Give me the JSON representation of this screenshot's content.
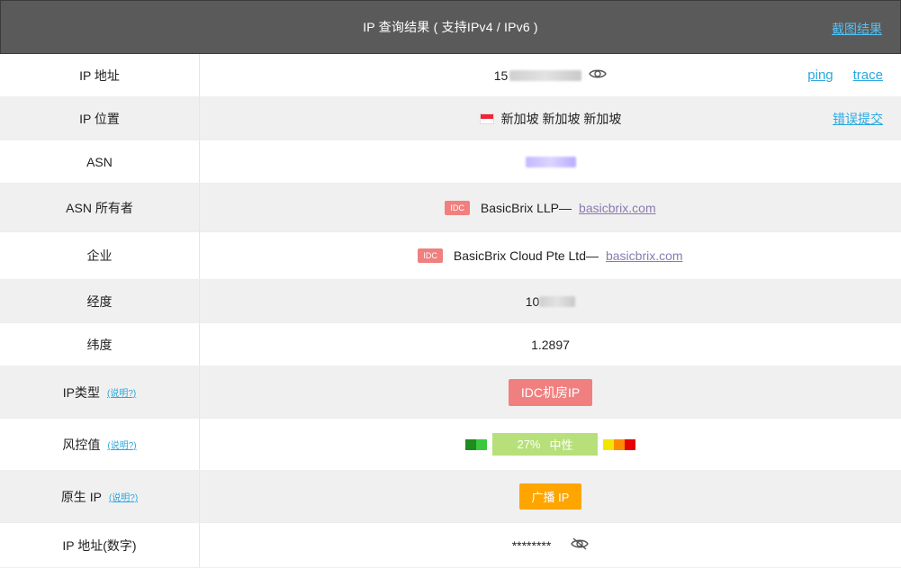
{
  "header": {
    "title": "IP 查询结果 ( 支持IPv4 / IPv6 )",
    "screenshot_link": "截图结果"
  },
  "rows": {
    "ip_address": {
      "label": "IP 地址",
      "value_prefix": "15",
      "links": [
        "ping",
        "trace"
      ]
    },
    "ip_location": {
      "label": "IP 位置",
      "value": "新加坡 新加坡 新加坡",
      "report_link": "错误提交"
    },
    "asn": {
      "label": "ASN"
    },
    "asn_owner": {
      "label": "ASN 所有者",
      "tag": "IDC",
      "name": "BasicBrix LLP—",
      "domain": "basicbrix.com"
    },
    "enterprise": {
      "label": "企业",
      "tag": "IDC",
      "name": "BasicBrix Cloud Pte Ltd—",
      "domain": "basicbrix.com"
    },
    "longitude": {
      "label": "经度",
      "value_prefix": "10"
    },
    "latitude": {
      "label": "纬度",
      "value": "1.2897"
    },
    "ip_type": {
      "label": "IP类型",
      "help": "(说明?)",
      "badge": "IDC机房IP"
    },
    "risk": {
      "label": "风控值",
      "help": "(说明?)",
      "percent": "27%",
      "level": "中性"
    },
    "native_ip": {
      "label": "原生 IP",
      "help": "(说明?)",
      "badge": "广播 IP"
    },
    "ip_numeric": {
      "label": "IP 地址(数字)",
      "value": "********"
    }
  },
  "colors": {
    "header_bg": "#5a5a5a",
    "link": "#29a8e0",
    "idc": "#f08080",
    "risk_neutral": "#b7e07a",
    "broadcast": "#ffa500"
  }
}
